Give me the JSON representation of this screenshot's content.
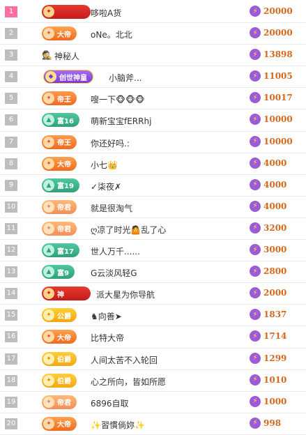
{
  "rows": [
    {
      "rank": "1",
      "badge": "",
      "badge_style": "b-god",
      "name": "哆啦A货",
      "score": "20000"
    },
    {
      "rank": "2",
      "badge": "大帝",
      "badge_style": "b-emperor",
      "name": "oNe。北北",
      "score": "20000"
    },
    {
      "rank": "3",
      "badge": "",
      "badge_style": "anon",
      "name": "神秘人",
      "score": "13898"
    },
    {
      "rank": "4",
      "badge": "创世神皇",
      "badge_style": "b-creator",
      "name": "小脑斧...",
      "score": "11005"
    },
    {
      "rank": "5",
      "badge": "帝王",
      "badge_style": "b-king",
      "name": "嗖一下🐵🐵🐵",
      "score": "10017"
    },
    {
      "rank": "6",
      "badge": "富16",
      "badge_style": "b-rich",
      "name": "萌新宝宝fERRhj",
      "score": "10000"
    },
    {
      "rank": "7",
      "badge": "帝王",
      "badge_style": "b-king",
      "name": "你还好吗.:",
      "score": "10000"
    },
    {
      "rank": "8",
      "badge": "大帝",
      "badge_style": "b-emperor",
      "name": "小七👑",
      "score": "4000"
    },
    {
      "rank": "9",
      "badge": "富19",
      "badge_style": "b-rich",
      "name": "✓柒夜✗",
      "score": "4000"
    },
    {
      "rank": "10",
      "badge": "帝君",
      "badge_style": "b-emperor b-fade",
      "name": "就是很淘气",
      "score": "4000"
    },
    {
      "rank": "11",
      "badge": "帝君",
      "badge_style": "b-emperor b-fade",
      "name": "ღ凉了时光🤷乱了心",
      "score": "3200"
    },
    {
      "rank": "12",
      "badge": "富17",
      "badge_style": "b-rich",
      "name": "世人万千......",
      "score": "3000"
    },
    {
      "rank": "13",
      "badge": "富9",
      "badge_style": "b-rich",
      "name": "G云淡风轻G",
      "score": "2800"
    },
    {
      "rank": "14",
      "badge": "神",
      "badge_style": "b-god",
      "name": "派大星为你导航",
      "score": "2000"
    },
    {
      "rank": "15",
      "badge": "公爵",
      "badge_style": "b-duke",
      "name": "♞向善➤",
      "score": "1837"
    },
    {
      "rank": "16",
      "badge": "大帝",
      "badge_style": "b-emperor",
      "name": "比特大帝",
      "score": "1714"
    },
    {
      "rank": "17",
      "badge": "伯爵",
      "badge_style": "b-earl",
      "name": "人间太苦不入轮回",
      "score": "1299"
    },
    {
      "rank": "18",
      "badge": "伯爵",
      "badge_style": "b-earl",
      "name": "心之所向，皆如所愿",
      "score": "1010"
    },
    {
      "rank": "19",
      "badge": "帝君",
      "badge_style": "b-emperor b-fade",
      "name": "6896自取",
      "score": "1000"
    },
    {
      "rank": "20",
      "badge": "大帝",
      "badge_style": "b-emperor",
      "name": "✨習慣倘妳✨",
      "score": "998"
    }
  ],
  "icons": {
    "score": "lightning-icon",
    "anon": "spy-icon"
  },
  "colors": {
    "rank_top": "#ff6fa3",
    "rank_default": "#bdbdbd",
    "score_text": "#d2691e",
    "score_icon": "#9b5bd6"
  }
}
